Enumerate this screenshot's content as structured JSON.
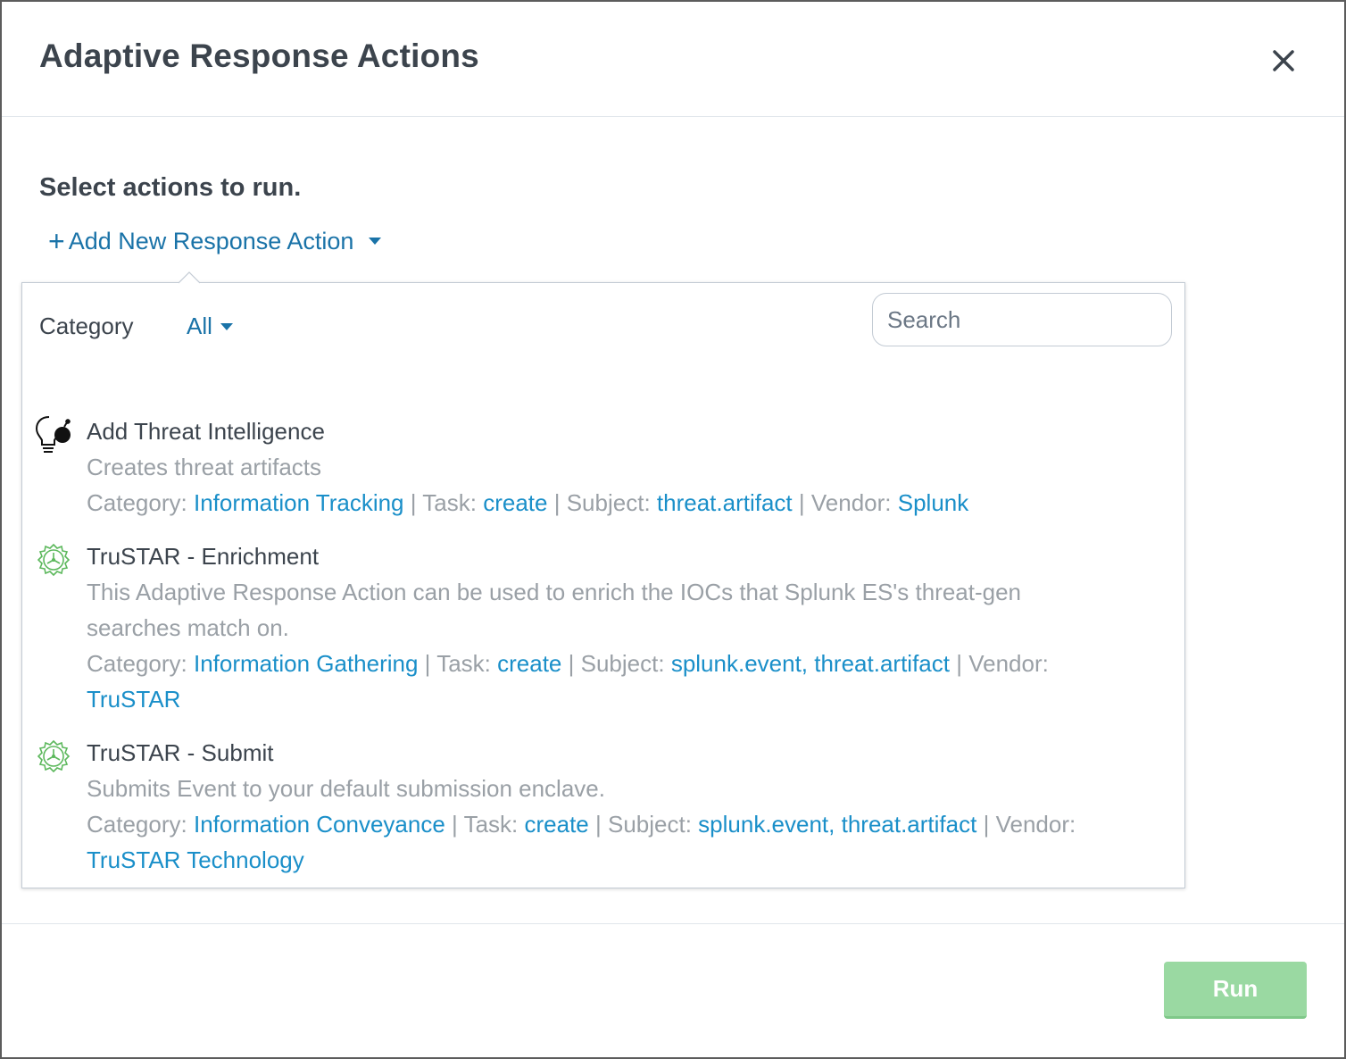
{
  "modal": {
    "title": "Adaptive Response Actions",
    "close_icon": "close-icon"
  },
  "prompt": "Select actions to run.",
  "add_action": {
    "plus": "+",
    "label": "Add New Response Action",
    "caret_icon": "caret-down-icon"
  },
  "popover": {
    "category_label": "Category",
    "category_value": "All",
    "search": {
      "placeholder": "Search",
      "value": ""
    }
  },
  "actions": [
    {
      "icon": "lightbulb-bomb-icon",
      "name": "Add Threat Intelligence",
      "description": "Creates threat artifacts",
      "category_label": "Category:",
      "category": "Information Tracking",
      "task_label": "Task:",
      "task": "create",
      "subject_label": "Subject:",
      "subject": "threat.artifact",
      "vendor_label": "Vendor:",
      "vendor": "Splunk"
    },
    {
      "icon": "trustar-gear-icon",
      "name": "TruSTAR - Enrichment",
      "description": "This Adaptive Response Action can be used to enrich the IOCs that Splunk ES's threat-gen searches match on.",
      "category_label": "Category:",
      "category": "Information Gathering",
      "task_label": "Task:",
      "task": "create",
      "subject_label": "Subject:",
      "subject": "splunk.event, threat.artifact",
      "vendor_label": "Vendor:",
      "vendor": "TruSTAR"
    },
    {
      "icon": "trustar-gear-icon",
      "name": "TruSTAR - Submit",
      "description": "Submits Event to your default submission enclave.",
      "category_label": "Category:",
      "category": "Information Conveyance",
      "task_label": "Task:",
      "task": "create",
      "subject_label": "Subject:",
      "subject": "splunk.event, threat.artifact",
      "vendor_label": "Vendor:",
      "vendor": "TruSTAR Technology"
    }
  ],
  "footer": {
    "run_label": "Run"
  },
  "colors": {
    "link": "#1a73a8",
    "meta_value": "#1a8fc9",
    "run_button": "#9ad9a2",
    "trustar_icon": "#5cb85c"
  }
}
